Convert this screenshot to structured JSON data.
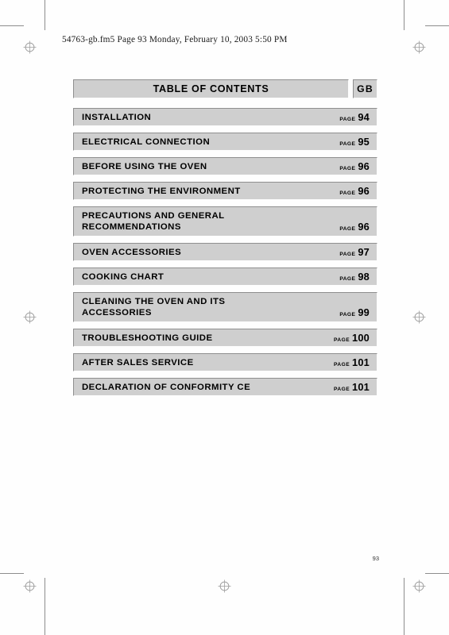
{
  "document": {
    "header_line": "54763-gb.fm5  Page 93  Monday, February 10, 2003  5:50 PM",
    "folio": "93"
  },
  "toc": {
    "title": "TABLE OF CONTENTS",
    "language_code": "GB",
    "page_word": "PAGE",
    "entries": [
      {
        "label": "INSTALLATION",
        "page": "94",
        "lines": 1
      },
      {
        "label": "ELECTRICAL CONNECTION",
        "page": "95",
        "lines": 1
      },
      {
        "label": "BEFORE USING THE OVEN",
        "page": "96",
        "lines": 1
      },
      {
        "label": "PROTECTING THE ENVIRONMENT",
        "page": "96",
        "lines": 1
      },
      {
        "label": "PRECAUTIONS AND GENERAL\nRECOMMENDATIONS",
        "page": "96",
        "lines": 2
      },
      {
        "label": "OVEN ACCESSORIES",
        "page": "97",
        "lines": 1
      },
      {
        "label": "COOKING CHART",
        "page": "98",
        "lines": 1
      },
      {
        "label": "CLEANING THE OVEN AND ITS\nACCESSORIES",
        "page": "99",
        "lines": 2
      },
      {
        "label": "TROUBLESHOOTING GUIDE",
        "page": "100",
        "lines": 1
      },
      {
        "label": "AFTER SALES SERVICE",
        "page": "101",
        "lines": 1
      },
      {
        "label": "DECLARATION OF CONFORMITY CE",
        "page": "101",
        "lines": 1
      }
    ]
  },
  "print_marks": {
    "registration_icon": "registration-target-icon",
    "positions": [
      "top-left",
      "top-right",
      "mid-left",
      "mid-right",
      "bottom-left",
      "bottom-center",
      "bottom-right"
    ]
  },
  "colors": {
    "panel_fill": "#cfcfcf",
    "panel_shadow": "#8f8f8f",
    "panel_highlight": "#fdfdfd",
    "text": "#000000",
    "mark": "#8d8d8d"
  }
}
